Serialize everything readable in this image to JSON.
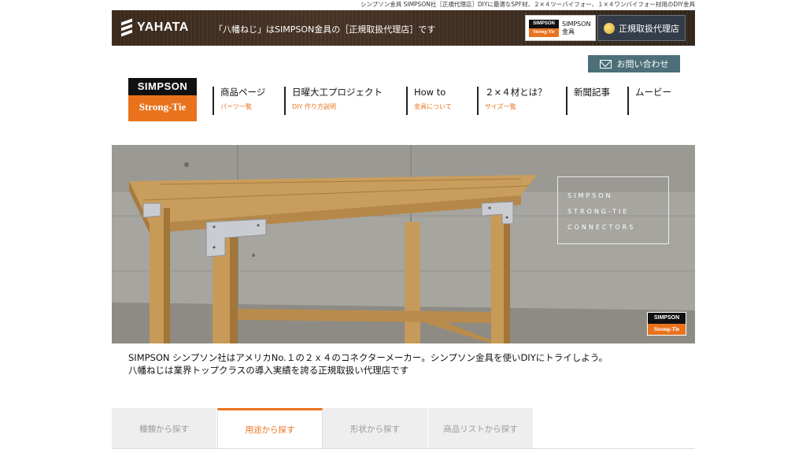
{
  "header": {
    "top_caption": "シンプソン金具 SIMPSON社［正規代理店］DIYに最適なSPF材、２×４ツーバイフォー、１×４ワンバイフォー材用のDIY金具",
    "logo_text": "YAHATA",
    "tagline": "「八幡ねじ」はSIMPSON金具の［正規取扱代理店］です",
    "badge_logo_top": "SIMPSON",
    "badge_logo_bottom": "Strong-Tie",
    "badge_line1": "SIMPSON",
    "badge_line2": "金具",
    "dealer_label": "正規取扱代理店",
    "contact_label": "お問い合わせ"
  },
  "site_logo": {
    "top": "SIMPSON",
    "bottom": "Strong-Tie"
  },
  "nav": [
    {
      "label": "商品ページ",
      "sub": "パーツ一覧"
    },
    {
      "label": "日曜大工プロジェクト",
      "sub": "DIY 作り方説明"
    },
    {
      "label": "How to",
      "sub": "金具について"
    },
    {
      "label": "２×４材とは？",
      "sub": "サイズ一覧"
    },
    {
      "label": "新聞記事",
      "sub": ""
    },
    {
      "label": "ムービー",
      "sub": ""
    }
  ],
  "hero": {
    "line1": "SIMPSON",
    "line2": "STRONG-TIE",
    "line3": "CONNECTORS",
    "logo_top": "SIMPSON",
    "logo_bottom": "Strong-Tie"
  },
  "intro": {
    "line1": "SIMPSON シンプソン社はアメリカNo.１の２ｘ４のコネクターメーカー。シンプソン金具を使いDIYにトライしよう。",
    "line2": "八幡ねじは業界トップクラスの導入実績を誇る正規取扱い代理店です"
  },
  "tabs": [
    {
      "label": "種類から探す",
      "active": false
    },
    {
      "label": "用途から探す",
      "active": true
    },
    {
      "label": "形状から探す",
      "active": false
    },
    {
      "label": "商品リストから探す",
      "active": false
    }
  ],
  "colors": {
    "accent": "#e9731d",
    "header_bg": "#3e2d20",
    "contact_bg": "#4c6f7a"
  }
}
